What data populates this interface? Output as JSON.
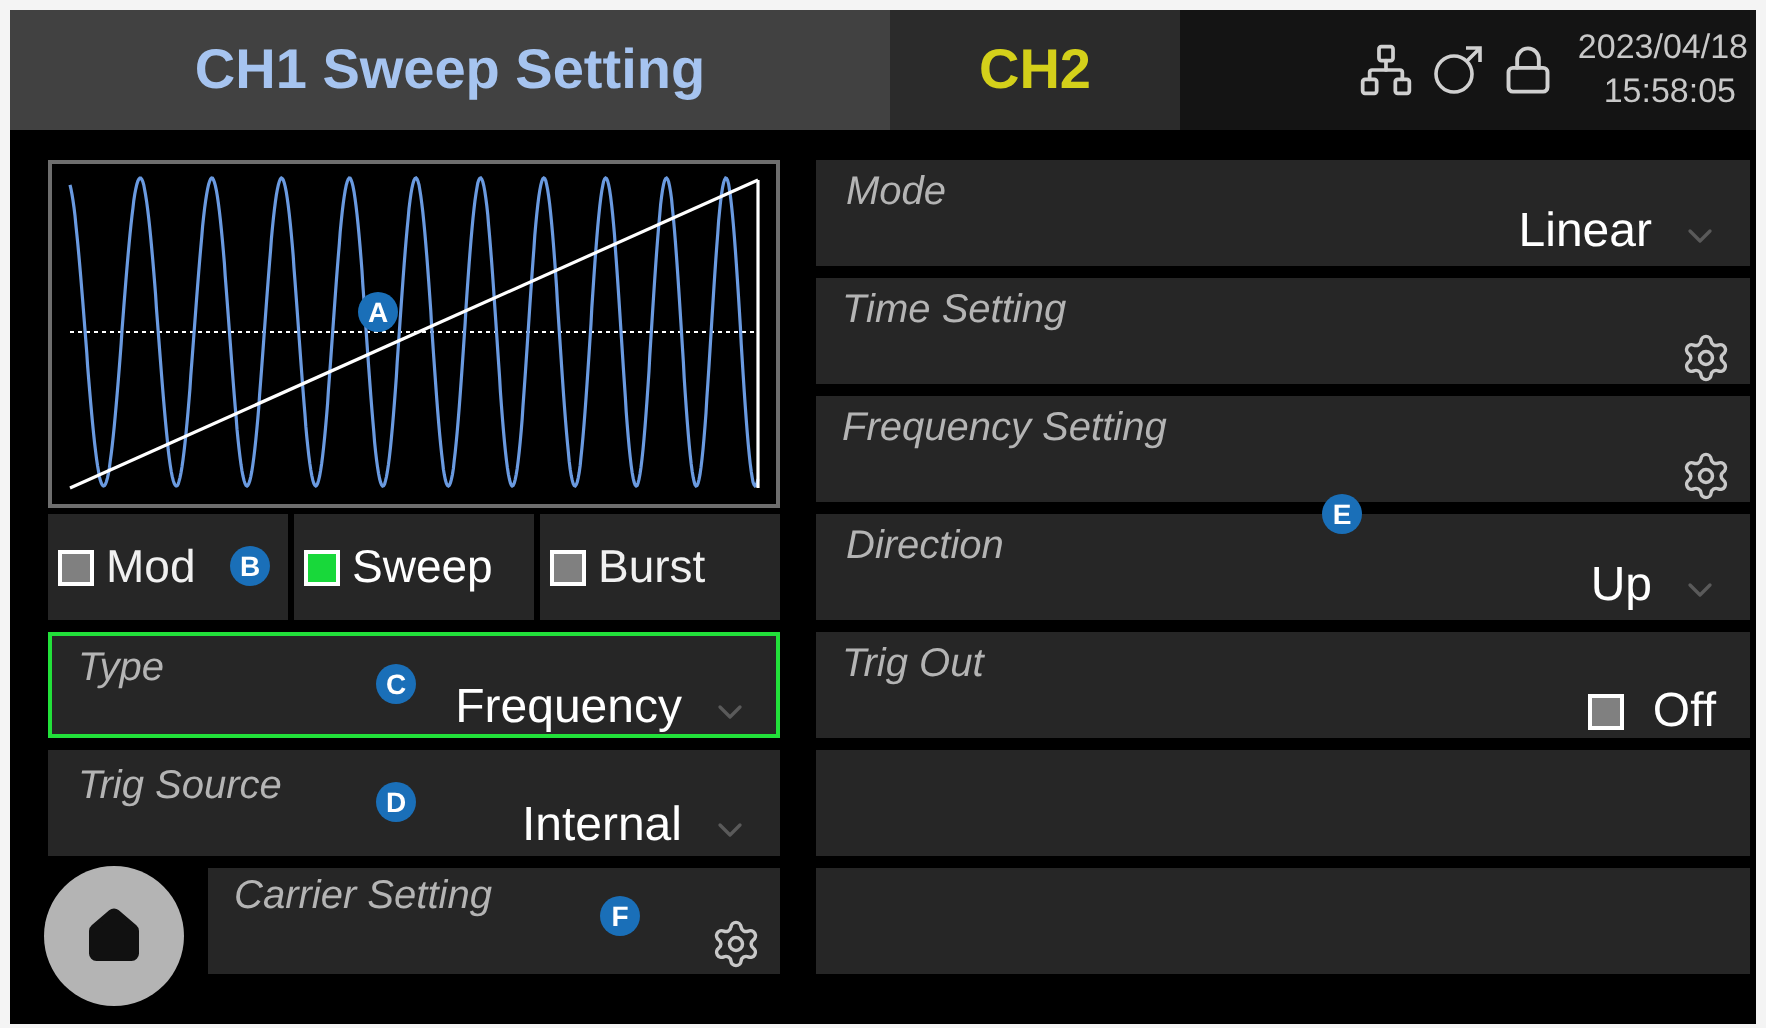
{
  "header": {
    "title": "CH1 Sweep Setting",
    "channel_tab": "CH2",
    "date": "2023/04/18",
    "time": "15:58:05"
  },
  "waveform": {
    "callout": "A"
  },
  "mode_tabs": [
    {
      "label": "Mod",
      "selected": false,
      "callout": "B"
    },
    {
      "label": "Sweep",
      "selected": true
    },
    {
      "label": "Burst",
      "selected": false
    }
  ],
  "left_fields": [
    {
      "label": "Type",
      "value": "Frequency",
      "focused": true,
      "callout": "C"
    },
    {
      "label": "Trig Source",
      "value": "Internal",
      "focused": false,
      "callout": "D"
    }
  ],
  "carrier": {
    "label": "Carrier Setting",
    "callout": "F"
  },
  "right_rows": [
    {
      "kind": "dropdown",
      "label": "Mode",
      "value": "Linear"
    },
    {
      "kind": "settings",
      "label": "Time Setting"
    },
    {
      "kind": "settings",
      "label": "Frequency Setting"
    },
    {
      "kind": "dropdown",
      "label": "Direction",
      "value": "Up"
    },
    {
      "kind": "toggle",
      "label": "Trig Out",
      "value": "Off",
      "checked": false
    },
    {
      "kind": "empty"
    },
    {
      "kind": "empty"
    }
  ],
  "right_callout": "E"
}
